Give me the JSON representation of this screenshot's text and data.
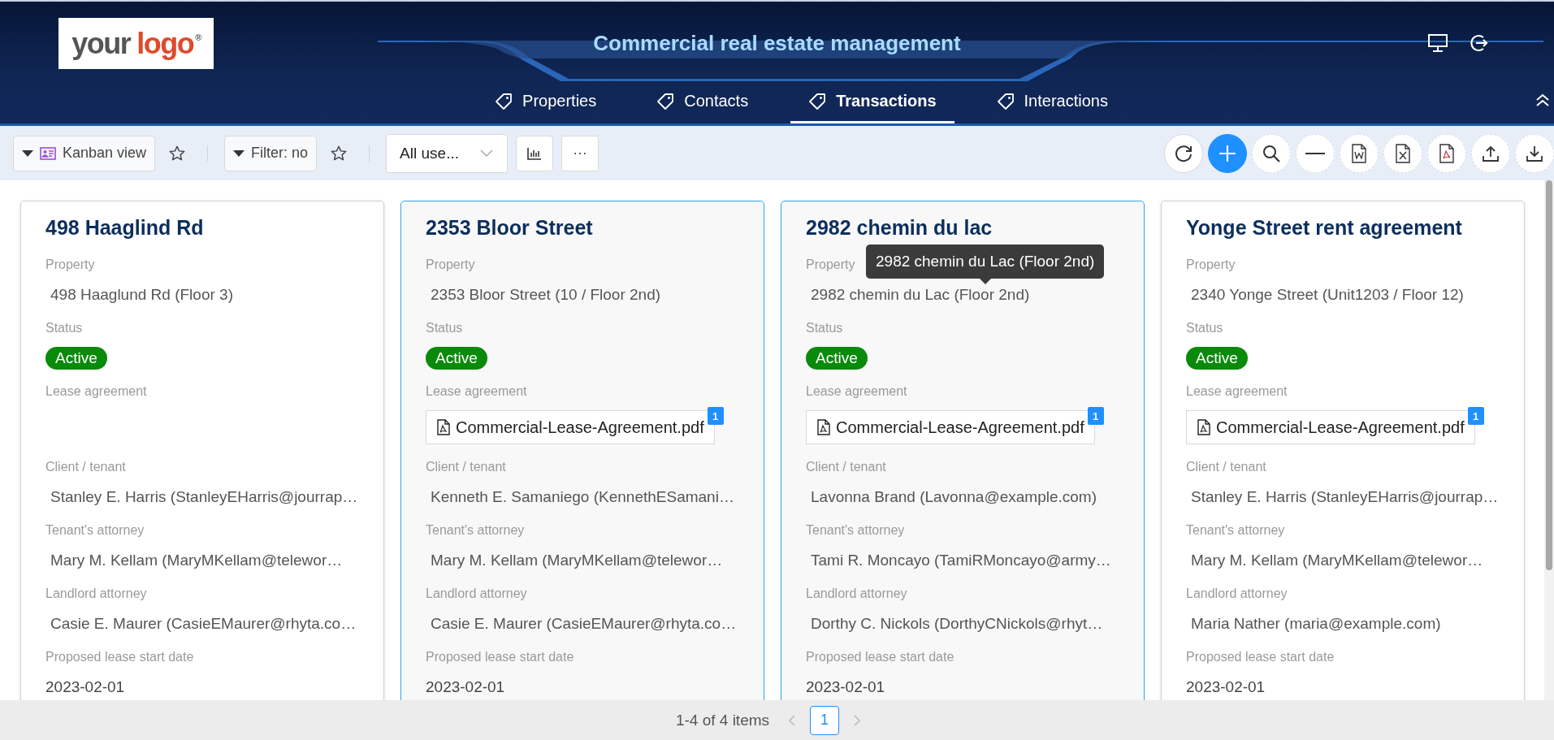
{
  "header": {
    "logo": {
      "part_1": "your",
      "part_2": "logo",
      "mark": "®"
    },
    "title": "Commercial real estate management"
  },
  "tabs": [
    {
      "label": "Properties",
      "selected": false
    },
    {
      "label": "Contacts",
      "selected": false
    },
    {
      "label": "Transactions",
      "selected": true
    },
    {
      "label": "Interactions",
      "selected": false
    }
  ],
  "toolbar": {
    "view": "Kanban view",
    "filter": "Filter: no",
    "user_select": "All use...",
    "more": "···"
  },
  "cards": [
    {
      "title": "498 Haaglind Rd",
      "selected": false,
      "fields": [
        {
          "kind": "text",
          "label": "Property",
          "value": "498 Haaglund Rd (Floor 3)"
        },
        {
          "kind": "badge",
          "label": "Status",
          "value": "Active"
        },
        {
          "kind": "file",
          "label": "Lease agreement"
        },
        {
          "kind": "text",
          "label": "Client / tenant",
          "value": "Stanley E. Harris (StanleyEHarris@jourrap…"
        },
        {
          "kind": "text",
          "label": "Tenant's attorney",
          "value": "Mary M. Kellam (MaryMKellam@telewor…"
        },
        {
          "kind": "text",
          "label": "Landlord attorney",
          "value": "Casie E. Maurer (CasieEMaurer@rhyta.co…"
        },
        {
          "kind": "date",
          "label": "Proposed lease start date",
          "value": "2023-02-01"
        }
      ]
    },
    {
      "title": "2353 Bloor Street",
      "selected": true,
      "fields": [
        {
          "kind": "text",
          "label": "Property",
          "value": "2353 Bloor Street (10 / Floor 2nd)"
        },
        {
          "kind": "badge",
          "label": "Status",
          "value": "Active"
        },
        {
          "kind": "file",
          "label": "Lease agreement",
          "value": "Commercial-Lease-Agreement.pdf",
          "count": "1"
        },
        {
          "kind": "text",
          "label": "Client / tenant",
          "value": "Kenneth E. Samaniego (KennethESamani…"
        },
        {
          "kind": "text",
          "label": "Tenant's attorney",
          "value": "Mary M. Kellam (MaryMKellam@telewor…"
        },
        {
          "kind": "text",
          "label": "Landlord attorney",
          "value": "Casie E. Maurer (CasieEMaurer@rhyta.co…"
        },
        {
          "kind": "date",
          "label": "Proposed lease start date",
          "value": "2023-02-01"
        }
      ]
    },
    {
      "title": "2982 chemin du lac",
      "selected": true,
      "tooltip": "2982 chemin du Lac (Floor 2nd)",
      "fields": [
        {
          "kind": "text",
          "label": "Property",
          "value": "2982 chemin du Lac (Floor 2nd)"
        },
        {
          "kind": "badge",
          "label": "Status",
          "value": "Active"
        },
        {
          "kind": "file",
          "label": "Lease agreement",
          "value": "Commercial-Lease-Agreement.pdf",
          "count": "1"
        },
        {
          "kind": "text",
          "label": "Client / tenant",
          "value": "Lavonna Brand (Lavonna@example.com)"
        },
        {
          "kind": "text",
          "label": "Tenant's attorney",
          "value": "Tami R. Moncayo (TamiRMoncayo@army…"
        },
        {
          "kind": "text",
          "label": "Landlord attorney",
          "value": "Dorthy C. Nickols (DorthyCNickols@rhyt…"
        },
        {
          "kind": "date",
          "label": "Proposed lease start date",
          "value": "2023-02-01"
        }
      ]
    },
    {
      "title": "Yonge Street rent agreement",
      "selected": false,
      "fields": [
        {
          "kind": "text",
          "label": "Property",
          "value": "2340 Yonge Street (Unit1203 / Floor 12)"
        },
        {
          "kind": "badge",
          "label": "Status",
          "value": "Active"
        },
        {
          "kind": "file",
          "label": "Lease agreement",
          "value": "Commercial-Lease-Agreement.pdf",
          "count": "1"
        },
        {
          "kind": "text",
          "label": "Client / tenant",
          "value": "Stanley E. Harris (StanleyEHarris@jourrap…"
        },
        {
          "kind": "text",
          "label": "Tenant's attorney",
          "value": "Mary M. Kellam (MaryMKellam@telewor…"
        },
        {
          "kind": "text",
          "label": "Landlord attorney",
          "value": "Maria Nather (maria@example.com)"
        },
        {
          "kind": "date",
          "label": "Proposed lease start date",
          "value": "2023-02-01"
        }
      ]
    }
  ],
  "pagination": {
    "summary": "1-4 of 4 items",
    "pages": [
      {
        "label": "1",
        "selected": true
      }
    ]
  }
}
